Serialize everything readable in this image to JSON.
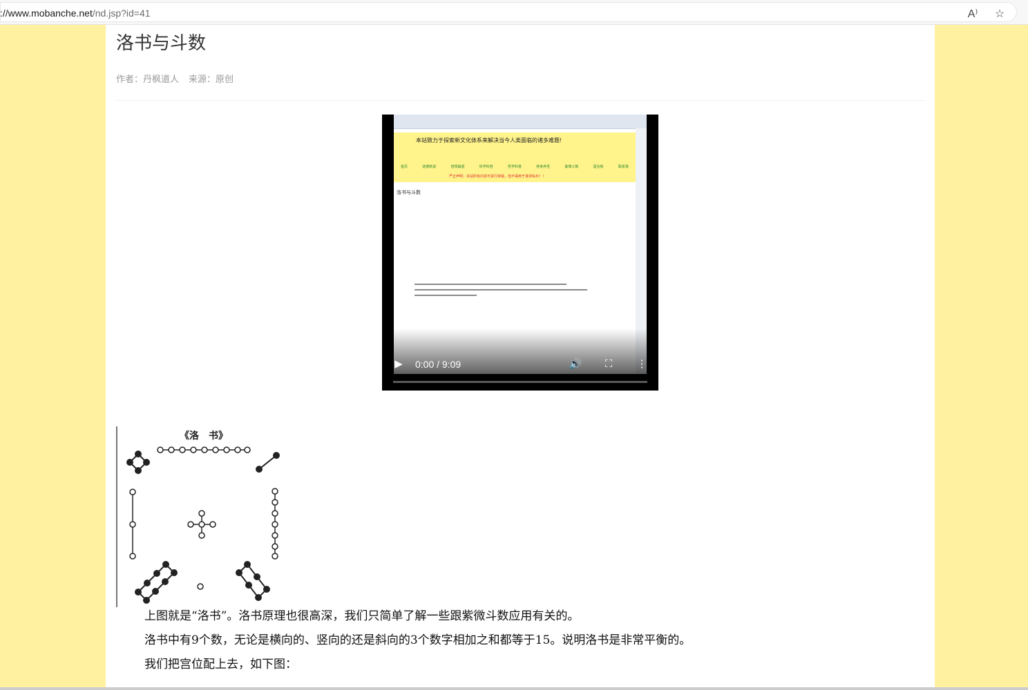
{
  "browser": {
    "url_host": "://www.mobanche.net",
    "url_path": "/nd.jsp?id=41",
    "read_aloud_label": "A⁾",
    "favorite_icon": "star-icon"
  },
  "article": {
    "title": "洛书与斗数",
    "author": "作者：丹枫道人",
    "source": "来源：原创",
    "paragraphs": [
      "上图就是“洛书”。洛书原理也很高深，我们只简单了解一些跟紫微斗数应用有关的。",
      "洛书中有9个数，无论是横向的、竖向的还是斜向的3个数字相加之和都等于15。说明洛书是非常平衡的。",
      "我们把宫位配上去，如下图："
    ]
  },
  "luoshu_image": {
    "caption": "《洛　书》"
  },
  "video": {
    "time": "0:00 / 9:09",
    "progress": 0,
    "frame": {
      "banner": "本站致力于探索新文化体系来解决当今人类面临的诸多难题!",
      "nav": [
        "首页",
        "道德新说",
        "管规解惑",
        "科学科普",
        "哲学科普",
        "修身养性",
        "紫微斗数",
        "留言板",
        "联系我"
      ],
      "warning": "严正声明：本站所有内容可进行转载，但不得用于谋求私利！！",
      "page_title": "洛书与斗数"
    }
  }
}
